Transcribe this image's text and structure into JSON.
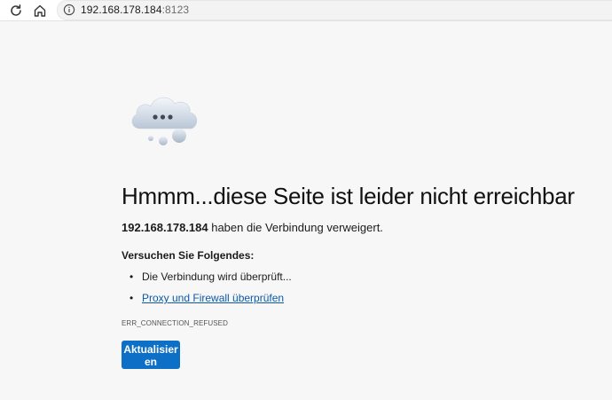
{
  "browser": {
    "address": {
      "host": "192.168.178.184",
      "port": ":8123"
    },
    "icons": {
      "refresh": "refresh-icon",
      "home": "home-icon",
      "info": "info-icon"
    }
  },
  "error_page": {
    "illustration": "cloud-icon",
    "title": "Hmmm...diese Seite ist leider nicht erreichbar",
    "refused_host": "192.168.178.184",
    "refused_message": " haben die Verbindung verweigert.",
    "try_heading": "Versuchen Sie Folgendes:",
    "suggestions": [
      "Die Verbindung wird überprüft...",
      "Proxy und Firewall überprüfen"
    ],
    "error_code": "ERR_CONNECTION_REFUSED",
    "reload_label": "Aktualisieren",
    "accent_color": "#0e6fc7",
    "link_color": "#0b5aa8"
  }
}
